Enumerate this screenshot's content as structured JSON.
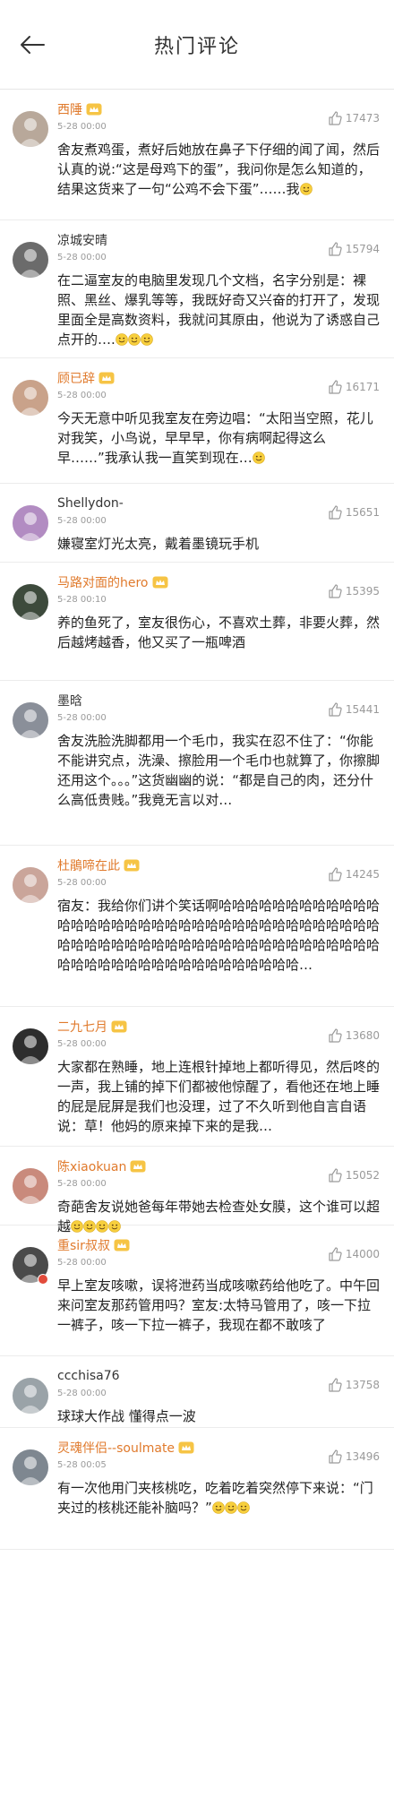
{
  "header": {
    "title": "热门评论",
    "back_icon": "arrow-left-icon"
  },
  "colors": {
    "vip_name": "#e07a2c",
    "meta": "#9a9a9a",
    "divider": "#ececec"
  },
  "comments": [
    {
      "name": "西陲",
      "vip": true,
      "time": "5-28 00:00",
      "likes": "17473",
      "text": "舍友煮鸡蛋，煮好后她放在鼻子下仔细的闻了闻，然后认真的说:“这是母鸡下的蛋”，我问你是怎么知道的，结果这货来了一句“公鸡不会下蛋”……我"
    },
    {
      "name": "凉城安晴",
      "vip": false,
      "time": "5-28 00:00",
      "likes": "15794",
      "text": "在二逼室友的电脑里发现几个文档，名字分别是：裸照、黑丝、爆乳等等，我既好奇又兴奋的打开了，发现里面全是高数资料，我就问其原由，他说为了诱惑自己点开的…."
    },
    {
      "name": "顾已辞",
      "vip": true,
      "time": "5-28 00:00",
      "likes": "16171",
      "text": "今天无意中听见我室友在旁边唱：“太阳当空照，花儿对我笑，小鸟说，早早早，你有病啊起得这么早……”我承认我一直笑到现在…"
    },
    {
      "name": "Shellydon-",
      "vip": false,
      "time": "5-28 00:00",
      "likes": "15651",
      "text": "嫌寝室灯光太亮，戴着墨镜玩手机"
    },
    {
      "name": "马路对面的hero",
      "vip": true,
      "time": "5-28 00:10",
      "likes": "15395",
      "text": "养的鱼死了，室友很伤心，不喜欢土葬，非要火葬，然后越烤越香，他又买了一瓶啤酒"
    },
    {
      "name": "墨晗",
      "vip": false,
      "time": "5-28 00:00",
      "likes": "15441",
      "text": "舍友洗脸洗脚都用一个毛巾，我实在忍不住了：“你能不能讲究点，洗澡、擦脸用一个毛巾也就算了，你擦脚还用这个。。。”这货幽幽的说：“都是自己的肉，还分什么高低贵贱。”我竟无言以对…"
    },
    {
      "name": "杜鵑啼在此",
      "vip": true,
      "time": "5-28 00:00",
      "likes": "14245",
      "text": "宿友：我给你们讲个笑话啊哈哈哈哈哈哈哈哈哈哈哈哈哈哈哈哈哈哈哈哈哈哈哈哈哈哈哈哈哈哈哈哈哈哈哈哈哈哈哈哈哈哈哈哈哈哈哈哈哈哈哈哈哈哈哈哈哈哈哈哈哈哈哈哈哈哈哈哈哈哈哈哈哈哈哈哈哈哈…"
    },
    {
      "name": "二九七月",
      "vip": true,
      "time": "5-28 00:00",
      "likes": "13680",
      "text": "大家都在熟睡，地上连根针掉地上都听得见，然后咚的一声，我上铺的掉下们都被他惊醒了，看他还在地上睡的屁是屁屏是我们也没理，过了不久听到他自言自语说：草！他妈的原来掉下来的是我…"
    },
    {
      "name": "陈xiaokuan",
      "vip": true,
      "time": "5-28 00:00",
      "likes": "15052",
      "text": "奇葩舍友说她爸每年带她去检查处女膜，这个谁可以超越"
    },
    {
      "name": "重sir叔叔",
      "vip": true,
      "time": "5-28 00:00",
      "likes": "14000",
      "text": "早上室友咳嗽，误将泄药当成咳嗽药给他吃了。中午回来问室友那药管用吗？室友:太特马管用了，咳一下拉一裤子，咳一下拉一裤子，我现在都不敢咳了"
    },
    {
      "name": "ccchisa76",
      "vip": false,
      "time": "5-28 00:00",
      "likes": "13758",
      "text": "球球大作战 懂得点一波"
    },
    {
      "name": "灵魂伴侣--soulmate",
      "vip": true,
      "time": "5-28 00:05",
      "likes": "13496",
      "text": "有一次他用门夹核桃吃，吃着吃着突然停下来说：“门夹过的核桃还能补脑吗？”"
    }
  ]
}
